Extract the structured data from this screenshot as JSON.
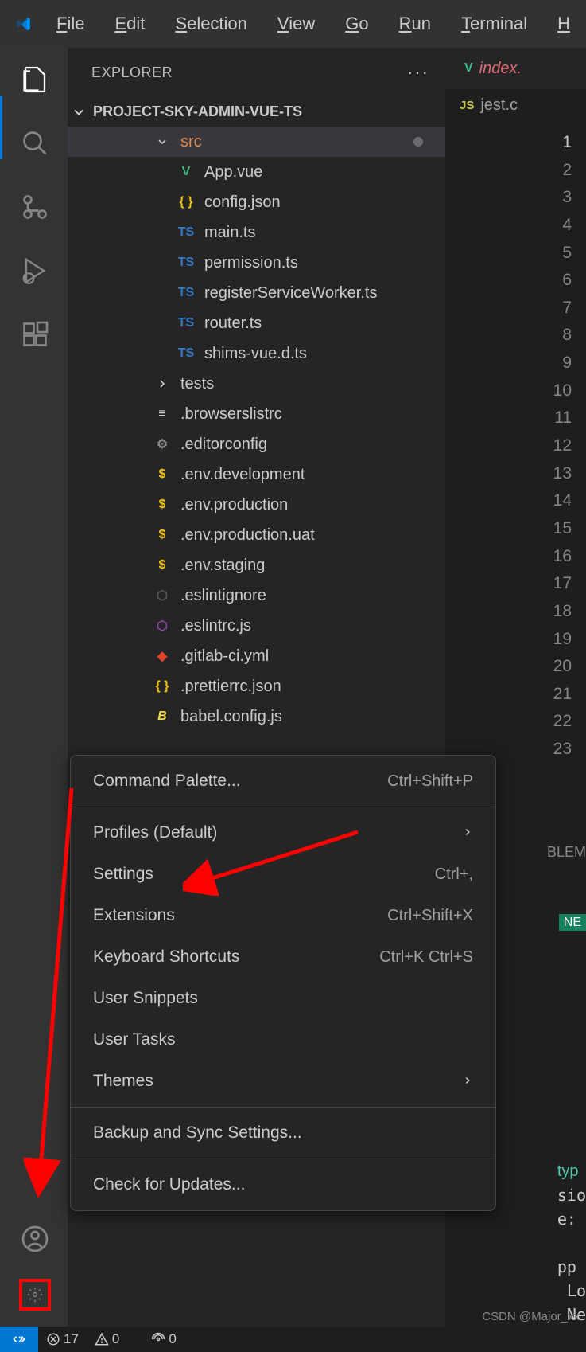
{
  "menubar": {
    "items": [
      "File",
      "Edit",
      "Selection",
      "View",
      "Go",
      "Run",
      "Terminal",
      "H"
    ]
  },
  "activitybar": {
    "top": [
      "explorer",
      "search",
      "source-control",
      "run-debug",
      "extensions"
    ],
    "bottom": [
      "accounts",
      "settings-gear"
    ]
  },
  "explorer": {
    "title": "EXPLORER",
    "project": "PROJECT-SKY-ADMIN-VUE-TS",
    "tree": [
      {
        "type": "folder",
        "label": "src",
        "depth": 1,
        "expanded": true,
        "selected": true,
        "dirty": true,
        "icon": "chevron-down",
        "iconColor": "#cccccc"
      },
      {
        "type": "file",
        "label": "App.vue",
        "depth": 2,
        "icon": "V",
        "iconColor": "#41b883"
      },
      {
        "type": "file",
        "label": "config.json",
        "depth": 2,
        "icon": "{ }",
        "iconColor": "#f1c40f"
      },
      {
        "type": "file",
        "label": "main.ts",
        "depth": 2,
        "icon": "TS",
        "iconColor": "#3178c6"
      },
      {
        "type": "file",
        "label": "permission.ts",
        "depth": 2,
        "icon": "TS",
        "iconColor": "#3178c6"
      },
      {
        "type": "file",
        "label": "registerServiceWorker.ts",
        "depth": 2,
        "icon": "TS",
        "iconColor": "#3178c6"
      },
      {
        "type": "file",
        "label": "router.ts",
        "depth": 2,
        "icon": "TS",
        "iconColor": "#3178c6"
      },
      {
        "type": "file",
        "label": "shims-vue.d.ts",
        "depth": 2,
        "icon": "TS",
        "iconColor": "#3178c6"
      },
      {
        "type": "folder",
        "label": "tests",
        "depth": 1,
        "expanded": false,
        "icon": "chevron-right",
        "iconColor": "#cccccc"
      },
      {
        "type": "file",
        "label": ".browserslistrc",
        "depth": 1,
        "icon": "≡",
        "iconColor": "#cccccc"
      },
      {
        "type": "file",
        "label": ".editorconfig",
        "depth": 1,
        "icon": "⚙",
        "iconColor": "#888888"
      },
      {
        "type": "file",
        "label": ".env.development",
        "depth": 1,
        "icon": "$",
        "iconColor": "#f1c40f"
      },
      {
        "type": "file",
        "label": ".env.production",
        "depth": 1,
        "icon": "$",
        "iconColor": "#f1c40f"
      },
      {
        "type": "file",
        "label": ".env.production.uat",
        "depth": 1,
        "icon": "$",
        "iconColor": "#f1c40f"
      },
      {
        "type": "file",
        "label": ".env.staging",
        "depth": 1,
        "icon": "$",
        "iconColor": "#f1c40f"
      },
      {
        "type": "file",
        "label": ".eslintignore",
        "depth": 1,
        "icon": "⬡",
        "iconColor": "#555555"
      },
      {
        "type": "file",
        "label": ".eslintrc.js",
        "depth": 1,
        "icon": "⬡",
        "iconColor": "#8e44ad"
      },
      {
        "type": "file",
        "label": ".gitlab-ci.yml",
        "depth": 1,
        "icon": "◆",
        "iconColor": "#e24329"
      },
      {
        "type": "file",
        "label": ".prettierrc.json",
        "depth": 1,
        "icon": "{ }",
        "iconColor": "#f1c40f"
      },
      {
        "type": "file",
        "label": "babel.config.js",
        "depth": 1,
        "icon": "B",
        "iconColor": "#f9dc3e",
        "italic": true
      }
    ]
  },
  "editor": {
    "tab_icon": "V",
    "tab_label": "index.",
    "breadcrumb_icon": "JS",
    "breadcrumb": "jest.c",
    "lines": 23,
    "active_line": 1
  },
  "context_menu": {
    "groups": [
      [
        {
          "label": "Command Palette...",
          "shortcut": "Ctrl+Shift+P"
        }
      ],
      [
        {
          "label": "Profiles (Default)",
          "submenu": true
        },
        {
          "label": "Settings",
          "shortcut": "Ctrl+,"
        },
        {
          "label": "Extensions",
          "shortcut": "Ctrl+Shift+X"
        },
        {
          "label": "Keyboard Shortcuts",
          "shortcut": "Ctrl+K Ctrl+S"
        },
        {
          "label": "User Snippets"
        },
        {
          "label": "User Tasks"
        },
        {
          "label": "Themes",
          "submenu": true
        }
      ],
      [
        {
          "label": "Backup and Sync Settings..."
        }
      ],
      [
        {
          "label": "Check for Updates..."
        }
      ]
    ]
  },
  "panel": {
    "tab": "BLEM",
    "badge": "NE"
  },
  "terminal": {
    "lines": [
      "typ",
      "sio",
      "e:",
      "",
      "pp",
      " Lo",
      " Ne"
    ]
  },
  "statusbar": {
    "errors": "17",
    "warnings": "0",
    "ports": "0"
  },
  "watermark": "CSDN @Major_xx"
}
